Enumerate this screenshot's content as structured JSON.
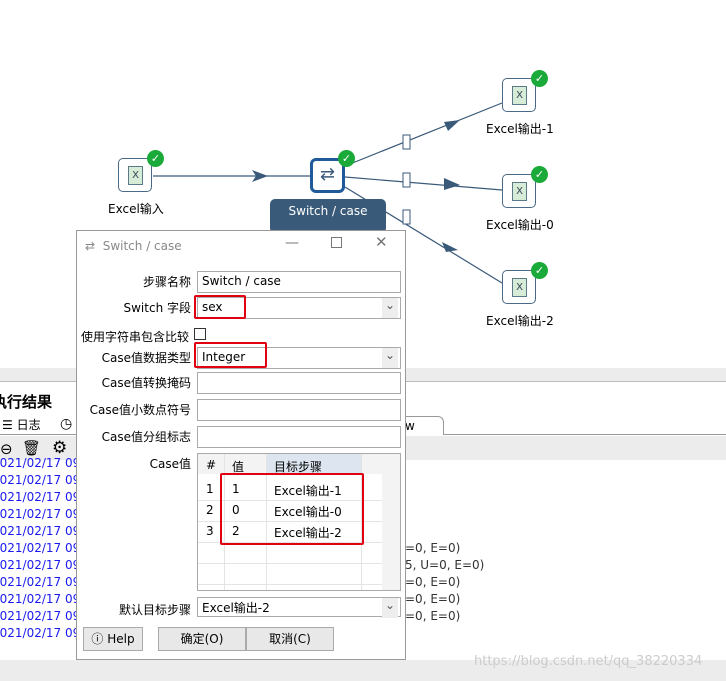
{
  "canvas": {
    "nodes": [
      {
        "label": "Excel输入",
        "icon": "excel-input-icon"
      },
      {
        "label": "Switch / case",
        "icon": "switch-case-icon"
      },
      {
        "label": "Excel输出-1",
        "icon": "excel-output-icon"
      },
      {
        "label": "Excel输出-0",
        "icon": "excel-output-icon"
      },
      {
        "label": "Excel输出-2",
        "icon": "excel-output-icon"
      }
    ],
    "tooltip": "Switch / case",
    "doc_glyph": "X"
  },
  "results": {
    "title": "执行结果",
    "tabs": [
      {
        "label": "日志"
      },
      {
        "label": "w data"
      }
    ],
    "log_lines": [
      "2021/02/17 09",
      "2021/02/17 09",
      "2021/02/17 09",
      "2021/02/17 09",
      "2021/02/17 09",
      "2021/02/17 09",
      "2021/02/17 09",
      "2021/02/17 09",
      "2021/02/17 09",
      "2021/02/17 09",
      "2021/02/17 09"
    ],
    "log_tails": [
      "=0, E=0)",
      "5, U=0, E=0)",
      "=0, E=0)",
      "=0, E=0)",
      "=0, E=0)"
    ]
  },
  "dialog": {
    "title": "Switch / case",
    "step_name_label": "步骤名称",
    "step_name_value": "Switch / case",
    "switch_field_label": "Switch 字段",
    "switch_field_value": "sex",
    "use_contains_label": "使用字符串包含比较",
    "use_contains_checked": false,
    "case_type_label": "Case值数据类型",
    "case_type_value": "Integer",
    "case_mask_label": "Case值转换掩码",
    "case_decimal_label": "Case值小数点符号",
    "case_group_label": "Case值分组标志",
    "case_values_label": "Case值",
    "table": {
      "headers": [
        "#",
        "值",
        "目标步骤"
      ],
      "rows": [
        [
          "1",
          "1",
          "Excel输出-1"
        ],
        [
          "2",
          "0",
          "Excel输出-0"
        ],
        [
          "3",
          "2",
          "Excel输出-2"
        ]
      ]
    },
    "default_target_label": "默认目标步骤",
    "default_target_value": "Excel输出-2",
    "help_label": "Help",
    "ok_label": "确定(O)",
    "cancel_label": "取消(C)"
  },
  "watermark": "https://blog.csdn.net/qq_38220334",
  "colors": {
    "highlight": "#e00010",
    "node_selected": "#1f5a9a",
    "ok": "#1aaa3a",
    "log_text": "#1a1aee"
  }
}
